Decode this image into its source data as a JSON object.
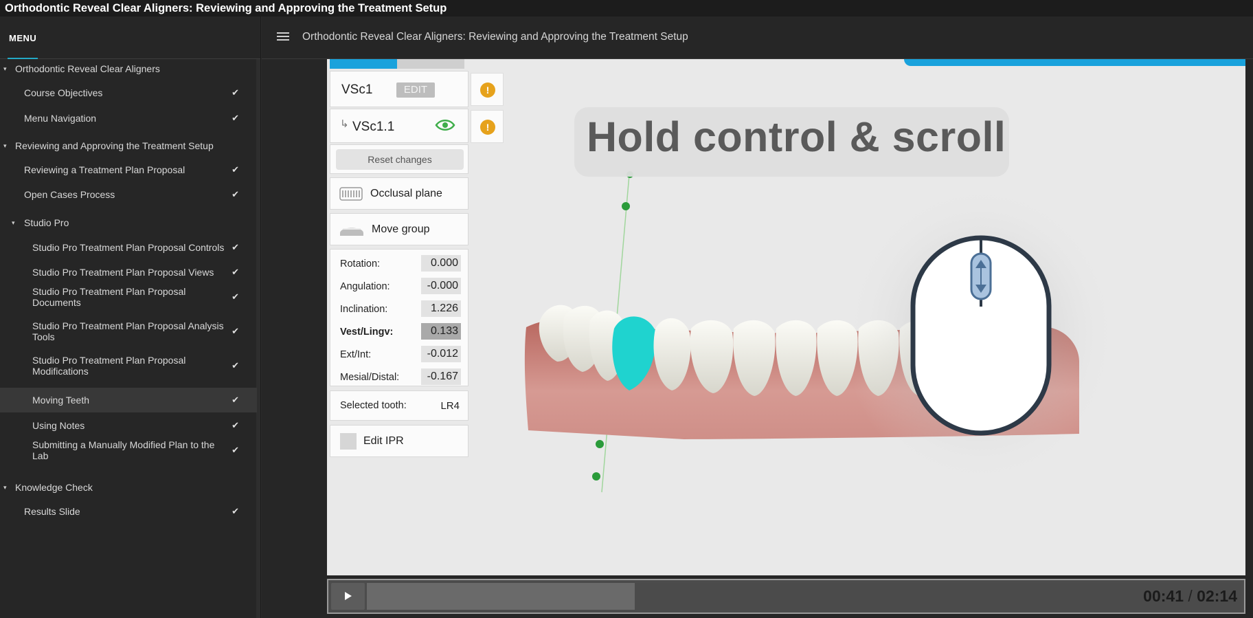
{
  "window_title": "Orthodontic Reveal Clear Aligners: Reviewing and Approving the Treatment Setup",
  "sidebar": {
    "menu_label": "MENU",
    "items": [
      {
        "label": "Orthodontic Reveal Clear Aligners",
        "level": 0,
        "check": false,
        "caret": "▾"
      },
      {
        "label": "Course Objectives",
        "level": 1,
        "check": true
      },
      {
        "label": "Menu Navigation",
        "level": 1,
        "check": true
      },
      {
        "label": "Reviewing and Approving the Treatment Setup",
        "level": 0,
        "check": false,
        "caret": "▾"
      },
      {
        "label": "Reviewing a Treatment Plan Proposal",
        "level": 1,
        "check": true
      },
      {
        "label": "Open Cases Process",
        "level": 1,
        "check": true
      },
      {
        "label": "Studio Pro",
        "level": 1,
        "check": false,
        "caret": "▾"
      },
      {
        "label": "Studio Pro Treatment Plan Proposal Controls",
        "level": 2,
        "check": true
      },
      {
        "label": "Studio Pro Treatment Plan Proposal Views",
        "level": 2,
        "check": true
      },
      {
        "label": "Studio Pro Treatment Plan Proposal Documents",
        "level": 2,
        "check": true
      },
      {
        "label": "Studio Pro Treatment Plan Proposal Analysis Tools",
        "level": 2,
        "check": true
      },
      {
        "label": "Studio Pro Treatment Plan Proposal Modifications",
        "level": 2,
        "check": true
      },
      {
        "label": "Moving Teeth",
        "level": 2,
        "check": true,
        "active": true
      },
      {
        "label": "Using Notes",
        "level": 2,
        "check": true
      },
      {
        "label": "Submitting a Manually Modified Plan to the Lab",
        "level": 2,
        "check": true
      },
      {
        "label": "Knowledge Check",
        "level": 0,
        "check": false,
        "caret": "▾"
      },
      {
        "label": "Results Slide",
        "level": 1,
        "check": true
      }
    ]
  },
  "header": {
    "menu_icon": "hamburger-icon",
    "title": "Orthodontic Reveal Clear Aligners: Reviewing and Approving the Treatment Setup"
  },
  "video": {
    "panel": {
      "scenario_1": "VSc1",
      "edit_label": "EDIT",
      "scenario_2": "VSc1.1",
      "reset_label": "Reset changes",
      "occlusal_label": "Occlusal plane",
      "move_group_label": "Move group",
      "params": [
        {
          "name": "Rotation:",
          "value": "0.000"
        },
        {
          "name": "Angulation:",
          "value": "-0.000"
        },
        {
          "name": "Inclination:",
          "value": "1.226"
        },
        {
          "name": "Vest/Lingv:",
          "value": "0.133",
          "selected": true
        },
        {
          "name": "Ext/Int:",
          "value": "-0.012"
        },
        {
          "name": "Mesial/Distal:",
          "value": "-0.167"
        }
      ],
      "selected_tooth_label": "Selected tooth:",
      "selected_tooth_value": "LR4",
      "edit_ipr_label": "Edit IPR"
    },
    "overlay_text": "Hold control & scroll",
    "colors": {
      "accent": "#1aa2dc",
      "warning": "#e6a21c",
      "tooth_highlight": "#1fd3cf",
      "gum": "#c98a82"
    }
  },
  "player": {
    "current_time": "00:41",
    "separator": "/",
    "total_time": "02:14",
    "progress": 0.306
  }
}
